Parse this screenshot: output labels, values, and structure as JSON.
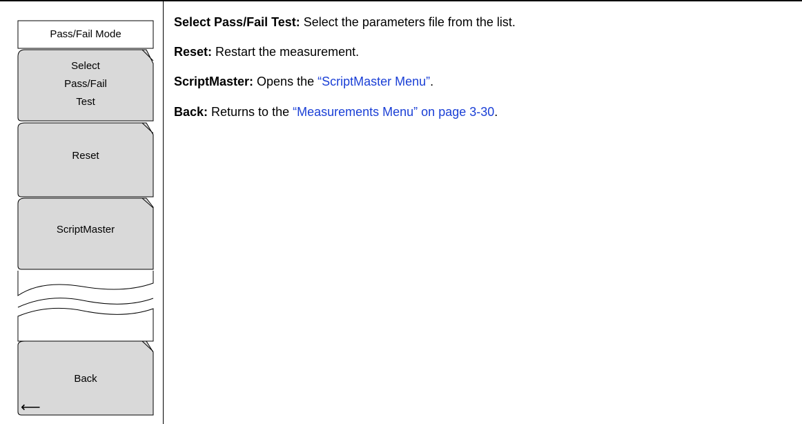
{
  "menu": {
    "title": "Pass/Fail Mode",
    "keys": [
      {
        "label_lines": [
          "Select",
          "Pass/Fail",
          "Test"
        ]
      },
      {
        "label": "Reset"
      },
      {
        "label": "ScriptMaster"
      },
      {
        "label": "Back",
        "icon": "back-arrow-icon"
      }
    ]
  },
  "descriptions": [
    {
      "term": "Select Pass/Fail Test:",
      "text": " Select the parameters file from the list."
    },
    {
      "term": "Reset:",
      "text": " Restart the measurement."
    },
    {
      "term": "ScriptMaster:",
      "text": " Opens the ",
      "link": "“ScriptMaster Menu”",
      "text_after": "."
    },
    {
      "term": "Back:",
      "text": " Returns to the ",
      "link": "“Measurements Menu” on page 3-30",
      "text_after": "."
    }
  ],
  "colors": {
    "link": "#1a3fd6",
    "key_fill": "#d9d9d9"
  }
}
